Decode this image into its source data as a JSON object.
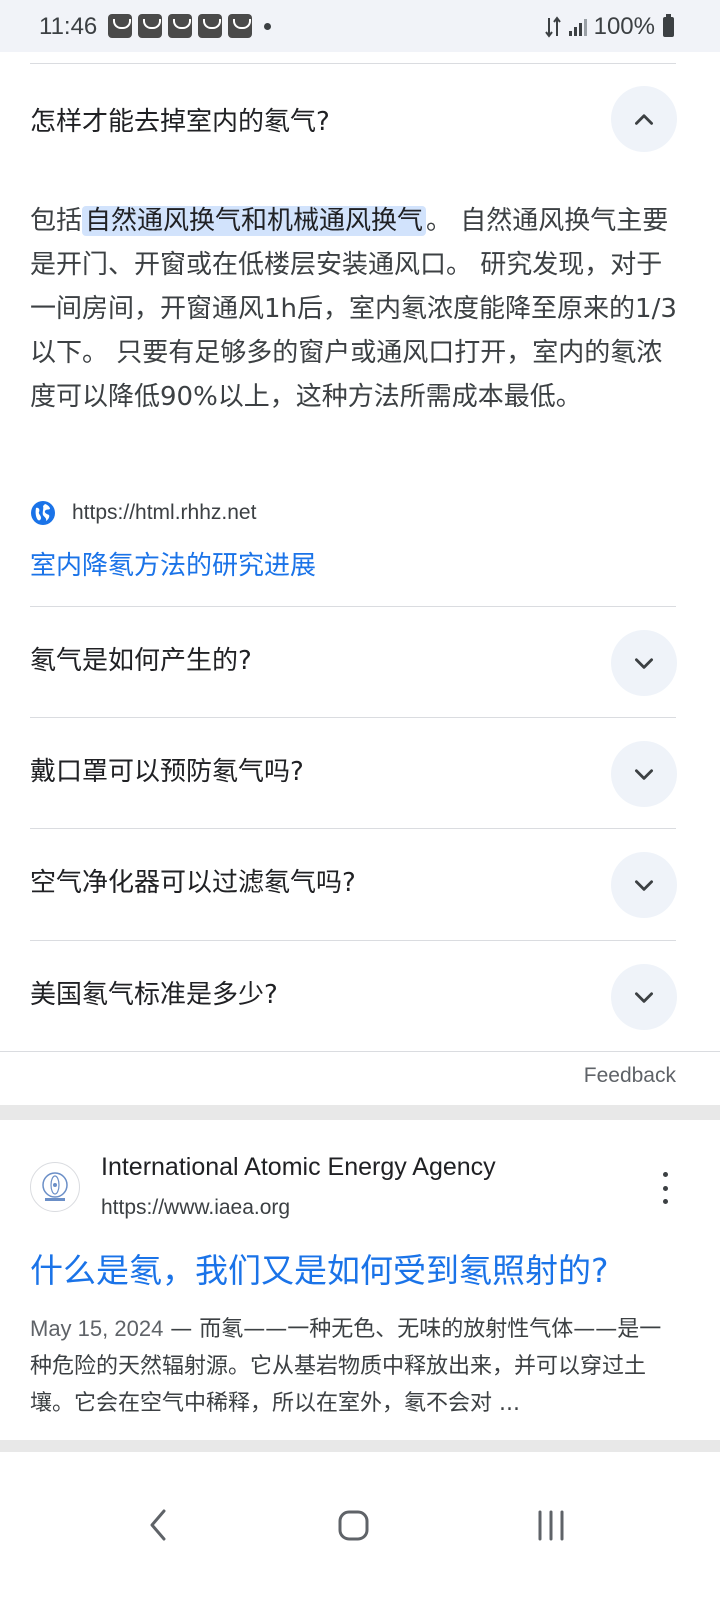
{
  "status_bar": {
    "time": "11:46",
    "battery": "100%",
    "icons": [
      "notification-icon",
      "notification-icon",
      "notification-icon",
      "notification-icon",
      "notification-icon",
      "dot-icon",
      "data-transfer-icon",
      "signal-icon",
      "battery-icon"
    ]
  },
  "expanded_question": {
    "title": "怎样才能去掉室内的氡气?",
    "answer_prefix": "包括",
    "answer_highlight": "自然通风换气和机械通风换气",
    "answer_rest": "。 自然通风换气主要是开门、开窗或在低楼层安装通风口。 研究发现，对于一间房间，开窗通风1h后，室内氡浓度能降至原来的1/3以下。 只要有足够多的窗户或通风口打开，室内的氡浓度可以降低90%以上，这种方法所需成本最低。",
    "source_url": "https://html.rhhz.net",
    "source_link": "室内降氡方法的研究进展"
  },
  "questions": [
    {
      "title": "氡气是如何产生的?"
    },
    {
      "title": "戴口罩可以预防氡气吗?"
    },
    {
      "title": "空气净化器可以过滤氡气吗?"
    },
    {
      "title": "美国氡气标准是多少?"
    }
  ],
  "feedback_label": "Feedback",
  "result": {
    "site_name": "International Atomic Energy Agency",
    "site_url": "https://www.iaea.org",
    "title": "什么是氡，我们又是如何受到氡照射的?",
    "date": "May 15, 2024",
    "snippet": " — 而氡——一种无色、无味的放射性气体——是一种危险的天然辐射源。它从基岩物质中释放出来，并可以穿过土壤。它会在空气中稀释，所以在室外，氡不会对 ..."
  },
  "colors": {
    "link": "#1a73e8",
    "highlight": "#d2e3fc",
    "chevron_bg": "#eff3f9"
  }
}
